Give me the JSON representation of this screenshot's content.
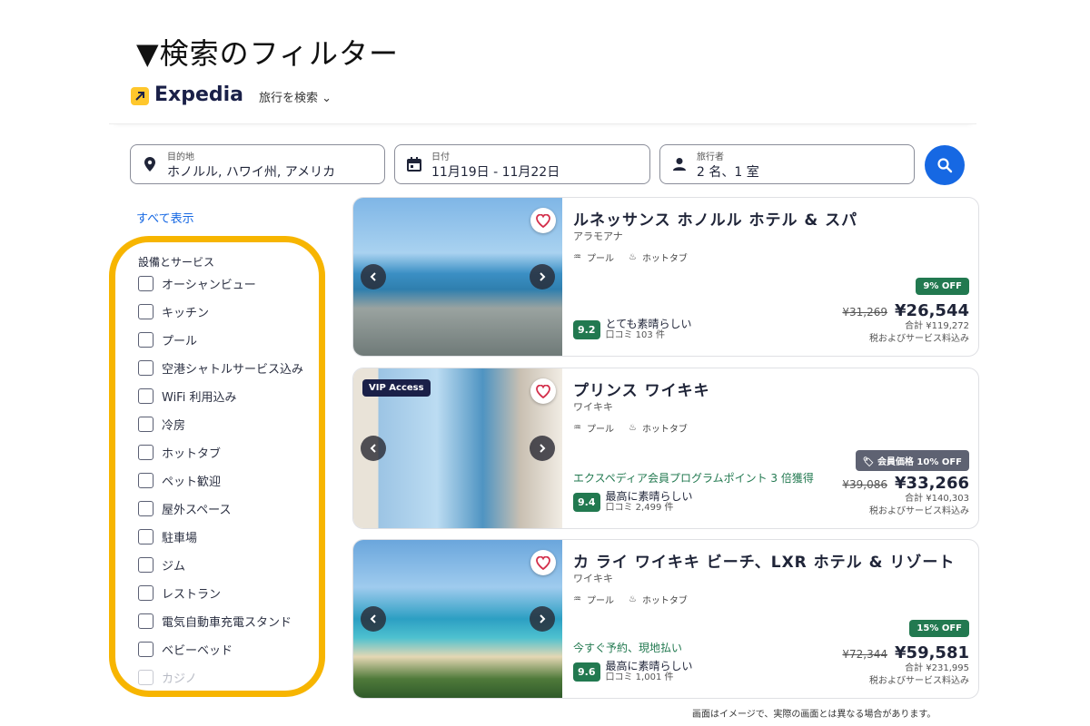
{
  "heading": "▼検索のフィルター",
  "header": {
    "logo": "Expedia",
    "nav": "旅行を検索"
  },
  "search": {
    "destination": {
      "label": "目的地",
      "value": "ホノルル, ハワイ州, アメリカ"
    },
    "dates": {
      "label": "日付",
      "value": "11月19日 - 11月22日"
    },
    "travelers": {
      "label": "旅行者",
      "value": "2 名、1 室"
    }
  },
  "filters": {
    "show_all": "すべて表示",
    "section_title": "設備とサービス",
    "items": [
      "オーシャンビュー",
      "キッチン",
      "プール",
      "空港シャトルサービス込み",
      "WiFi 利用込み",
      "冷房",
      "ホットタブ",
      "ペット歓迎",
      "屋外スペース",
      "駐車場",
      "ジム",
      "レストラン",
      "電気自動車充電スタンド",
      "ベビーベッド",
      "カジノ"
    ]
  },
  "hotels": [
    {
      "name": "ルネッサンス ホノルル ホテル & スパ",
      "area": "アラモアナ",
      "amenities": [
        "プール",
        "ホットタブ"
      ],
      "promo": "",
      "score": "9.2",
      "rating_text": "とても素晴らしい",
      "reviews": "口コミ 103 件",
      "badge": "9% OFF",
      "badge_color": "#227950",
      "old_price": "¥31,269",
      "price": "¥26,544",
      "total": "合計 ¥119,272",
      "tax": "税およびサービス料込み"
    },
    {
      "name": "プリンス ワイキキ",
      "area": "ワイキキ",
      "vip": "VIP Access",
      "amenities": [
        "プール",
        "ホットタブ"
      ],
      "promo": "エクスペディア会員プログラムポイント 3 倍獲得",
      "score": "9.4",
      "rating_text": "最高に素晴らしい",
      "reviews": "口コミ 2,499 件",
      "badge": "会員価格 10% OFF",
      "badge_color": "#5e6272",
      "old_price": "¥39,086",
      "price": "¥33,266",
      "total": "合計 ¥140,303",
      "tax": "税およびサービス料込み"
    },
    {
      "name": "カ ライ ワイキキ ビーチ、LXR ホテル & リゾート",
      "area": "ワイキキ",
      "amenities": [
        "プール",
        "ホットタブ"
      ],
      "promo": "今すぐ予約、現地払い",
      "score": "9.6",
      "rating_text": "最高に素晴らしい",
      "reviews": "口コミ 1,001 件",
      "badge": "15% OFF",
      "badge_color": "#227950",
      "old_price": "¥72,344",
      "price": "¥59,581",
      "total": "合計 ¥231,995",
      "tax": "税およびサービス料込み"
    }
  ],
  "footnote": "画面はイメージで、実際の画面とは異なる場合があります。",
  "colors": {
    "accent": "#1668e3",
    "highlight": "#f7b500",
    "good": "#227950"
  }
}
